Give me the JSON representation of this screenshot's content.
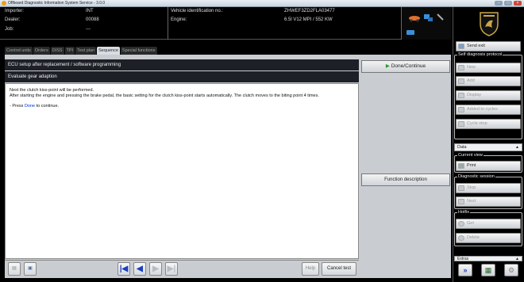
{
  "window": {
    "title": "Offboard Diagnostic Information System Service - 3.0.0"
  },
  "header": {
    "importer_label": "Importer:",
    "importer_value": "INT",
    "dealer_label": "Dealer:",
    "dealer_value": "00088",
    "job_label": "Job:",
    "job_value": "---",
    "vin_label": "Vehicle identification no.:",
    "vin_value": "ZHWEF3ZD2FLA03477",
    "engine_label": "Engine:",
    "engine_value": "6.5l V12 MPI / 552 KW"
  },
  "tabs": [
    {
      "label": "Control units"
    },
    {
      "label": "Orders"
    },
    {
      "label": "DISS"
    },
    {
      "label": "TPI"
    },
    {
      "label": "Test plan"
    },
    {
      "label": "Sequence"
    },
    {
      "label": "Special functions"
    }
  ],
  "main": {
    "title1": "ECU setup after replacement / software programming",
    "title2": "Evaluate gear adaption",
    "para1": "Next the clutch kiss-point will be performed.",
    "para2": "After starting the engine and pressing the brake pedal, the basic setting for the clutch kiss-point starts automatically. The clutch moves to the biting point 4 times.",
    "press_prefix": "- Press ",
    "press_done": "Done",
    "press_suffix": " to continue."
  },
  "right_panel": {
    "done_button": "Done/Continue",
    "func_desc_button": "Function description"
  },
  "bottom": {
    "help": "Help",
    "cancel_test": "Cancel test"
  },
  "sidebar": {
    "send_exit": "Send exit",
    "self_diag_label": "Self diagnosis protocol",
    "self_diag_buttons": [
      {
        "label": "New"
      },
      {
        "label": "Add"
      },
      {
        "label": "Display"
      },
      {
        "label": "Added to cycles"
      },
      {
        "label": "Cycle stop"
      }
    ],
    "data_header": "Data",
    "current_view_label": "Current view",
    "print": "Print",
    "diag_session_label": "Diagnostic session",
    "stop": "Stop",
    "next": "Next",
    "hotfix_label": "Hotfix",
    "get": "Get",
    "delete": "Delete",
    "extras_header": "Extras"
  }
}
